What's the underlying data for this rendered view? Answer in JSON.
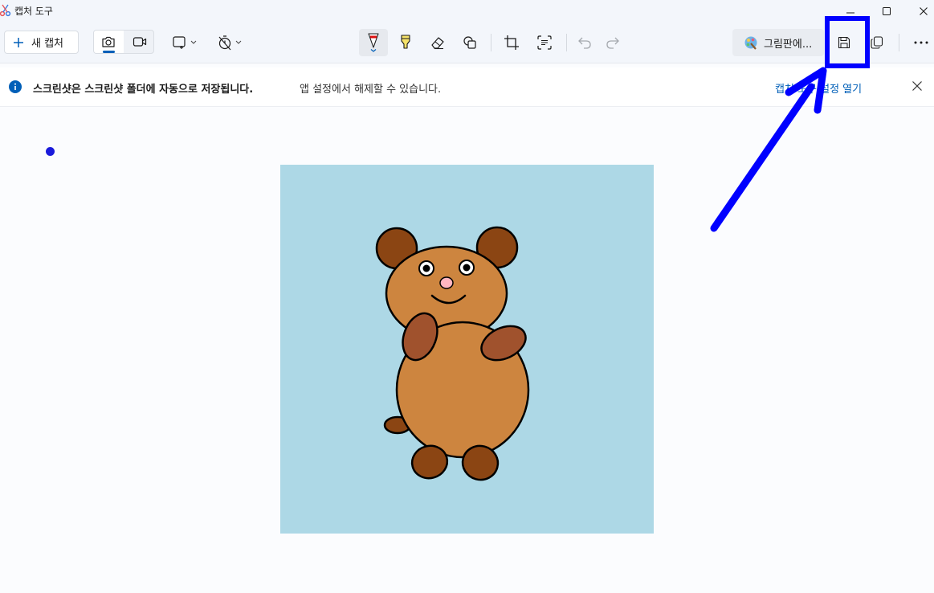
{
  "window": {
    "title": "캡처 도구"
  },
  "toolbar": {
    "new_capture_label": "새 캡처",
    "open_in_paint_label": "그림판에..."
  },
  "infobar": {
    "bold_text": "스크린샷은 스크린샷 폴더에 자동으로 저장됩니다.",
    "text": "앱 설정에서 해제할 수 있습니다.",
    "link_text": "캡처 도구 설정 열기"
  },
  "colors": {
    "accent": "#005fb8",
    "annotation_blue": "#0000ff",
    "captured_background": "#add8e6",
    "bear_body": "#cd853f",
    "bear_ears_paws": "#8b4513",
    "bear_arms": "#a0522d"
  },
  "icons": [
    "snipping-tool-icon",
    "plus-icon",
    "camera-icon",
    "video-icon",
    "rectangle-snip-icon",
    "timer-icon",
    "ballpoint-pen-icon",
    "highlighter-icon",
    "eraser-icon",
    "shapes-icon",
    "crop-icon",
    "text-actions-icon",
    "undo-icon",
    "redo-icon",
    "paint-icon",
    "save-icon",
    "copy-icon",
    "more-icon",
    "info-icon",
    "close-icon"
  ]
}
